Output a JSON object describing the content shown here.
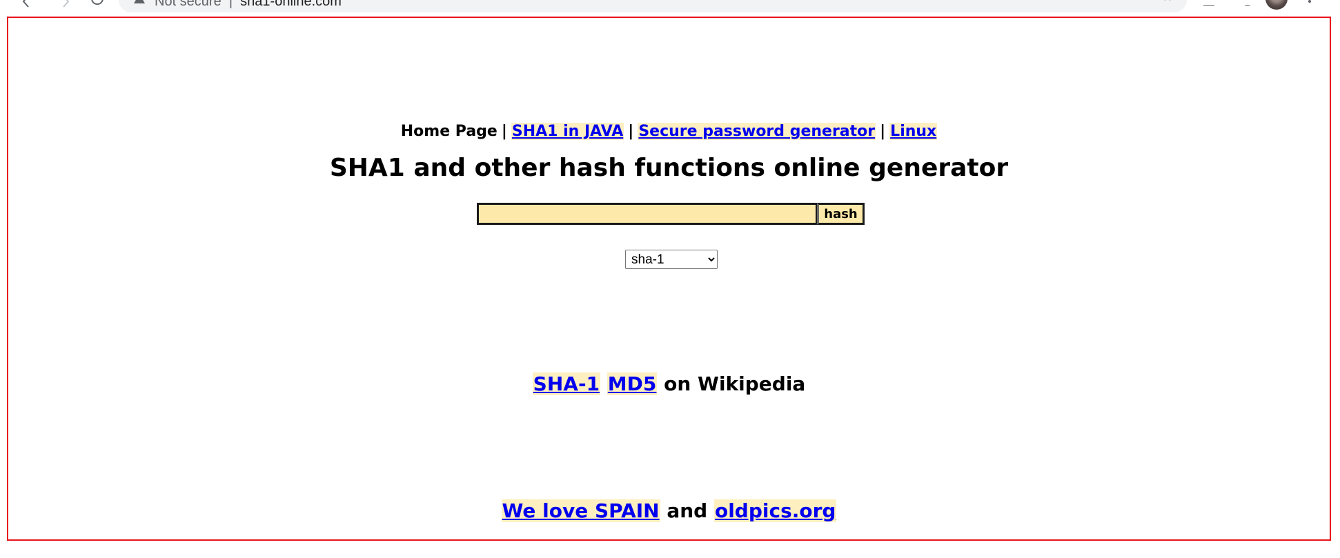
{
  "browser": {
    "security_label": "Not secure",
    "url_separator": "|",
    "url_host": "sha1-online.com"
  },
  "nav": {
    "home_label": "Home Page",
    "separator": "|",
    "sha1_java_label": "SHA1 in JAVA",
    "password_generator_label": "Secure password generator",
    "linux_label": "Linux"
  },
  "title": "SHA1 and other hash functions online generator",
  "form": {
    "input_value": "",
    "button_label": "hash",
    "selected_algorithm": "sha-1"
  },
  "wiki": {
    "sha1_link": "SHA-1",
    "md5_link": "MD5",
    "suffix": "on Wikipedia"
  },
  "footer": {
    "spain_link": "We love SPAIN",
    "and_text": "and",
    "oldpics_link": "oldpics.org"
  },
  "colors": {
    "frame_border": "#e8121b",
    "link": "#0000ee",
    "highlight": "#fdefc0",
    "input_bg": "#fde9a9"
  }
}
